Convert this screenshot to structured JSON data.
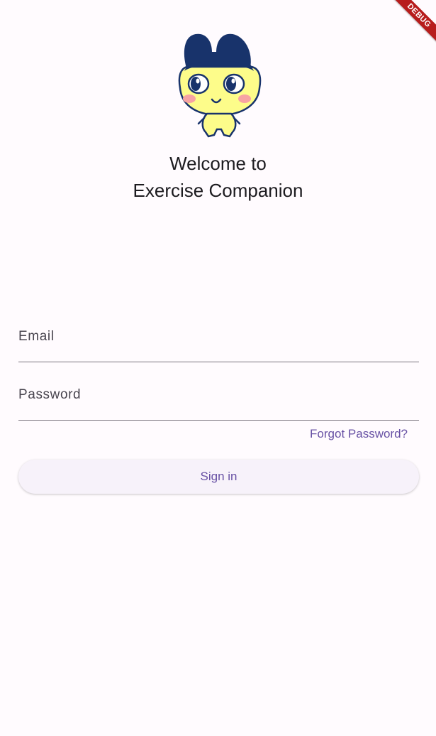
{
  "debug_banner": {
    "label": "DEBUG"
  },
  "welcome": {
    "line1": "Welcome to",
    "line2": "Exercise Companion"
  },
  "login_form": {
    "email_label": "Email",
    "password_label": "Password",
    "forgot_password": "Forgot Password?",
    "sign_in": "Sign in"
  },
  "mascot": {
    "icon": "tamagotchi-mascot-icon"
  },
  "colors": {
    "background": "#fffbfe",
    "accent": "#6750a4",
    "mascot_hair": "#18336b",
    "mascot_skin": "#fdfc8a",
    "mascot_cheek": "#f7a3a3",
    "debug_ribbon": "#b71c1c"
  }
}
